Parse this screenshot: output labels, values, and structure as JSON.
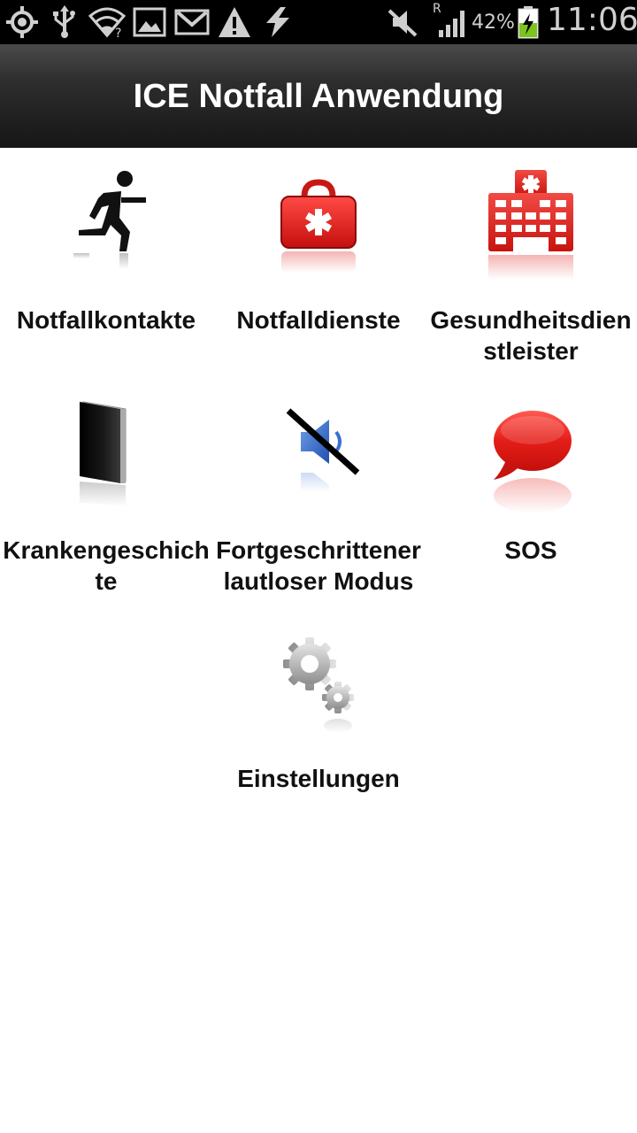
{
  "status_bar": {
    "battery_percent": "42%",
    "clock": "11:06",
    "roaming": "R",
    "icons": [
      "gps-icon",
      "usb-icon",
      "wifi-icon",
      "image-icon",
      "gmail-icon",
      "warning-icon",
      "sync-icon",
      "mute-icon",
      "signal-icon",
      "battery-icon"
    ]
  },
  "app": {
    "title": "ICE Notfall Anwendung"
  },
  "tiles": [
    {
      "label": "Notfallkontakte",
      "icon": "running-man-icon"
    },
    {
      "label": "Notfalldienste",
      "icon": "first-aid-kit-icon"
    },
    {
      "label": "Gesundheitsdien\nstleister",
      "icon": "hospital-icon"
    },
    {
      "label": "Krankengeschich\nte",
      "icon": "book-icon"
    },
    {
      "label": "Fortgeschrittener\nlautloser Modus",
      "icon": "muted-speaker-icon"
    },
    {
      "label": "SOS",
      "icon": "speech-bubble-icon"
    },
    {
      "label": "Einstellungen",
      "icon": "gears-icon"
    }
  ],
  "colors": {
    "accent_red": "#d8201e",
    "title_bar": "#1e1e1e"
  }
}
